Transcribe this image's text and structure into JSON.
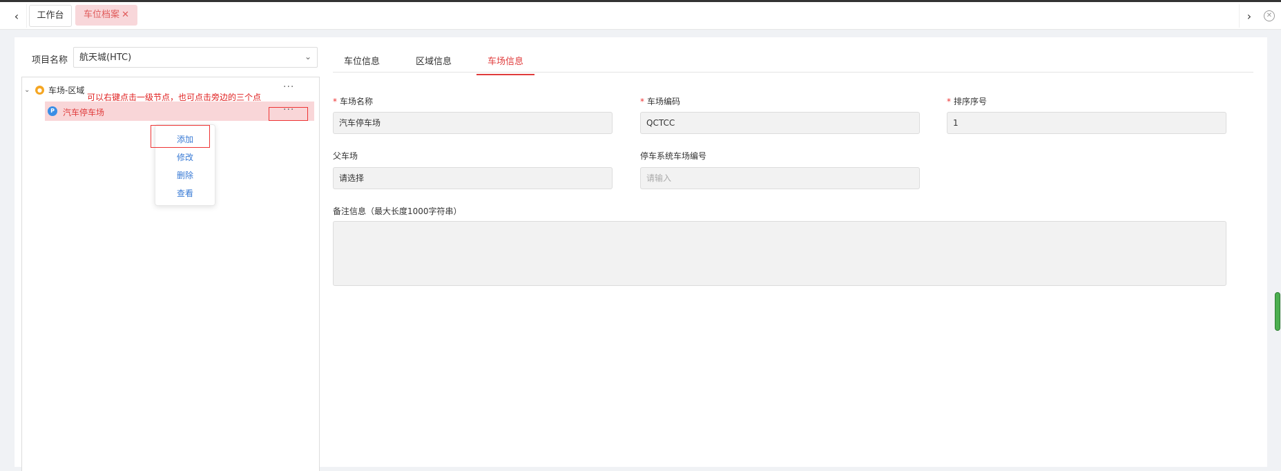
{
  "tabbar": {
    "tabs": [
      {
        "label": "工作台"
      },
      {
        "label": "车位档案",
        "close": "✕"
      }
    ]
  },
  "project": {
    "label": "项目名称",
    "value": "航天城(HTC)"
  },
  "tree": {
    "root": {
      "label": "车场-区域",
      "more": "···"
    },
    "child": {
      "label": "汽车停车场",
      "badge": "P",
      "more": "···"
    },
    "annotation": "可以右键点击一级节点，也可点击旁边的三个点"
  },
  "context_menu": {
    "items": [
      "添加",
      "修改",
      "删除",
      "查看"
    ]
  },
  "right_tabs": [
    "车位信息",
    "区域信息",
    "车场信息"
  ],
  "form": {
    "yard_name": {
      "label": "车场名称",
      "value": "汽车停车场",
      "required": true
    },
    "yard_code": {
      "label": "车场编码",
      "value": "QCTCC",
      "required": true
    },
    "sort_order": {
      "label": "排序序号",
      "value": "1",
      "required": true
    },
    "parent_yard": {
      "label": "父车场",
      "placeholder": "请选择"
    },
    "system_code": {
      "label": "停车系统车场编号",
      "placeholder": "请输入"
    },
    "remarks": {
      "label": "备注信息（最大长度1000字符串）"
    }
  },
  "colors": {
    "accent": "#e03c3c",
    "link": "#3a7bd5"
  }
}
